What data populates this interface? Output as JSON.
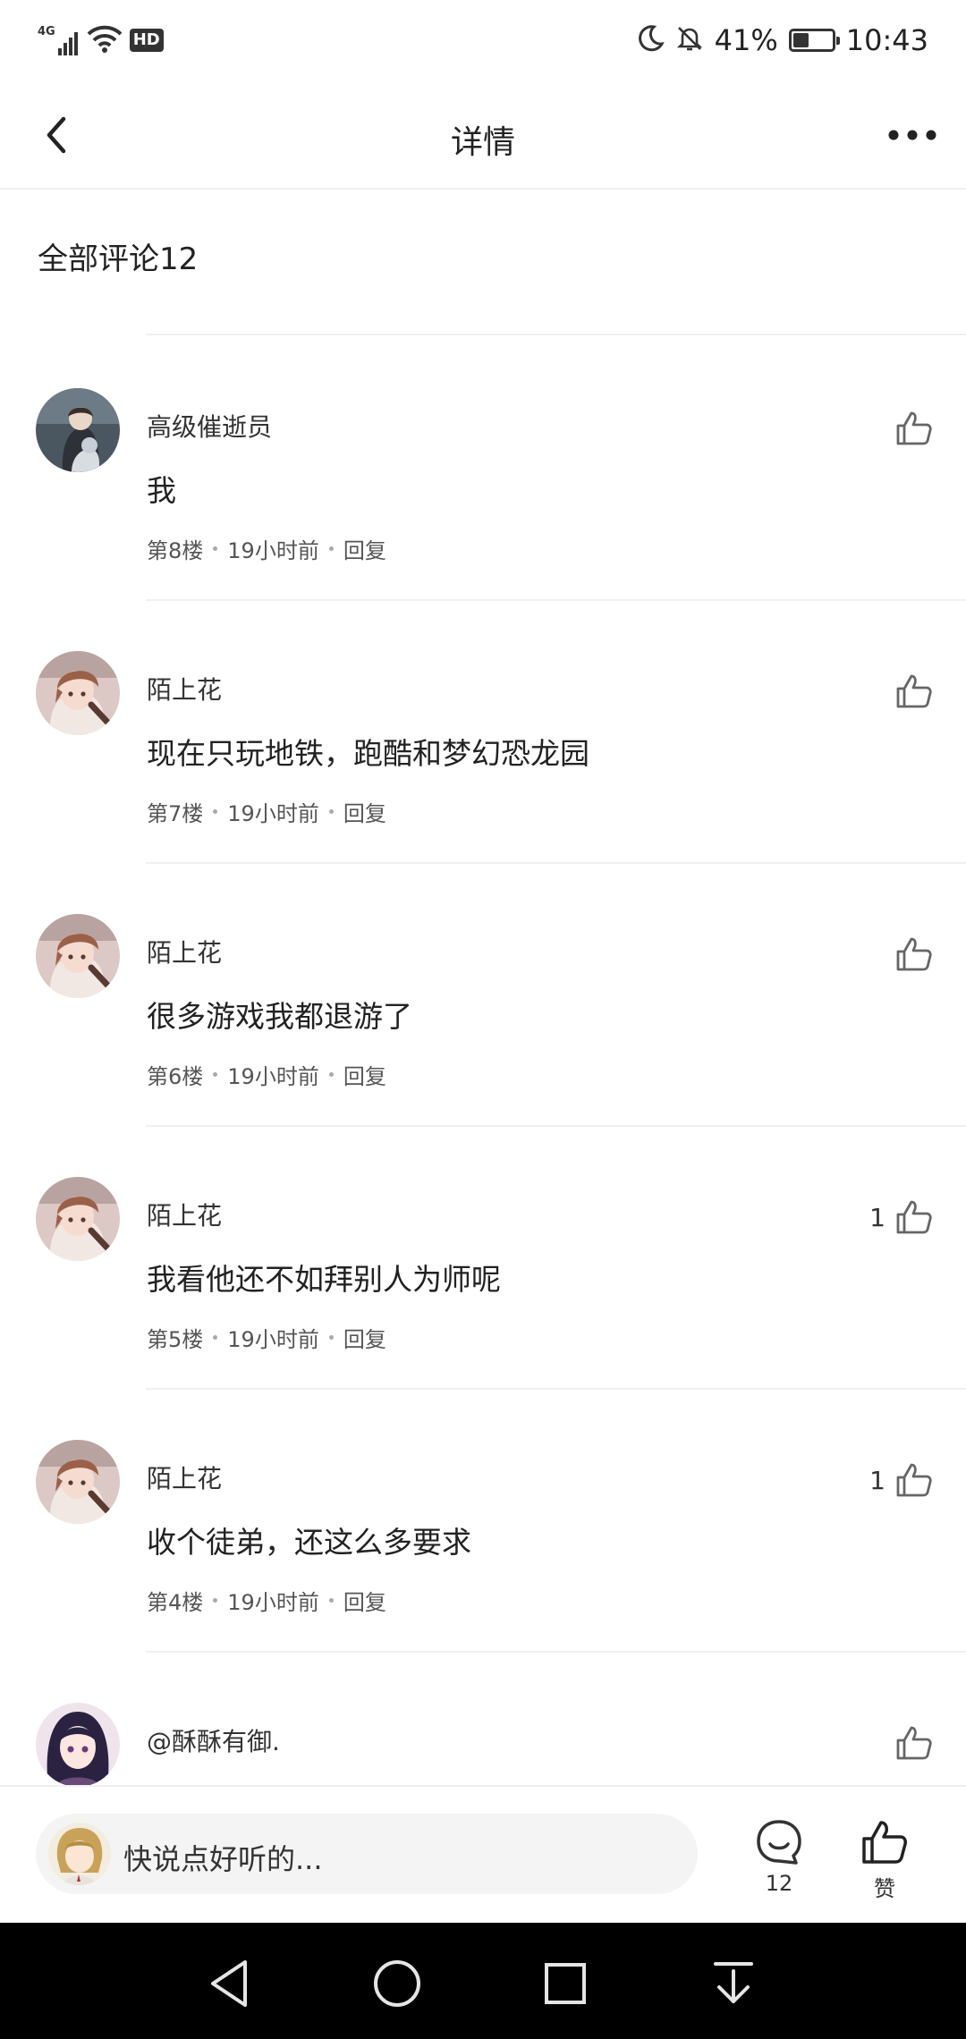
{
  "status_bar": {
    "network": "4G",
    "hd": "HD",
    "battery_percent": "41%",
    "battery_level": 0.41,
    "time": "10:43"
  },
  "header": {
    "title": "详情"
  },
  "section": {
    "heading": "全部评论12"
  },
  "comments": [
    {
      "name": "高级催逝员",
      "text": "我",
      "floor": "第8楼",
      "time": "19小时前",
      "reply": "回复",
      "likes": ""
    },
    {
      "name": "陌上花",
      "text": "现在只玩地铁，跑酷和梦幻恐龙园",
      "floor": "第7楼",
      "time": "19小时前",
      "reply": "回复",
      "likes": ""
    },
    {
      "name": "陌上花",
      "text": "很多游戏我都退游了",
      "floor": "第6楼",
      "time": "19小时前",
      "reply": "回复",
      "likes": ""
    },
    {
      "name": "陌上花",
      "text": "我看他还不如拜别人为师呢",
      "floor": "第5楼",
      "time": "19小时前",
      "reply": "回复",
      "likes": "1"
    },
    {
      "name": "陌上花",
      "text": "收个徒弟，还这么多要求",
      "floor": "第4楼",
      "time": "19小时前",
      "reply": "回复",
      "likes": "1"
    },
    {
      "name": "@酥酥有御.",
      "text": "",
      "floor": "",
      "time": "",
      "reply": "",
      "likes": ""
    }
  ],
  "input_bar": {
    "placeholder": "快说点好听的...",
    "comment_count": "12",
    "like_label": "赞"
  },
  "icons": {
    "back": "chevron-left-icon",
    "more": "more-dots-icon",
    "like": "thumbs-up-icon",
    "comment": "comment-bubble-icon",
    "nav_back": "triangle-back-icon",
    "nav_home": "circle-home-icon",
    "nav_recent": "square-recent-icon",
    "nav_notifications": "pull-down-icon"
  },
  "colors": {
    "text": "#222222",
    "divider": "#f0f0f0",
    "nav_bar": "#000000",
    "input_bg": "#f4f4f4"
  }
}
